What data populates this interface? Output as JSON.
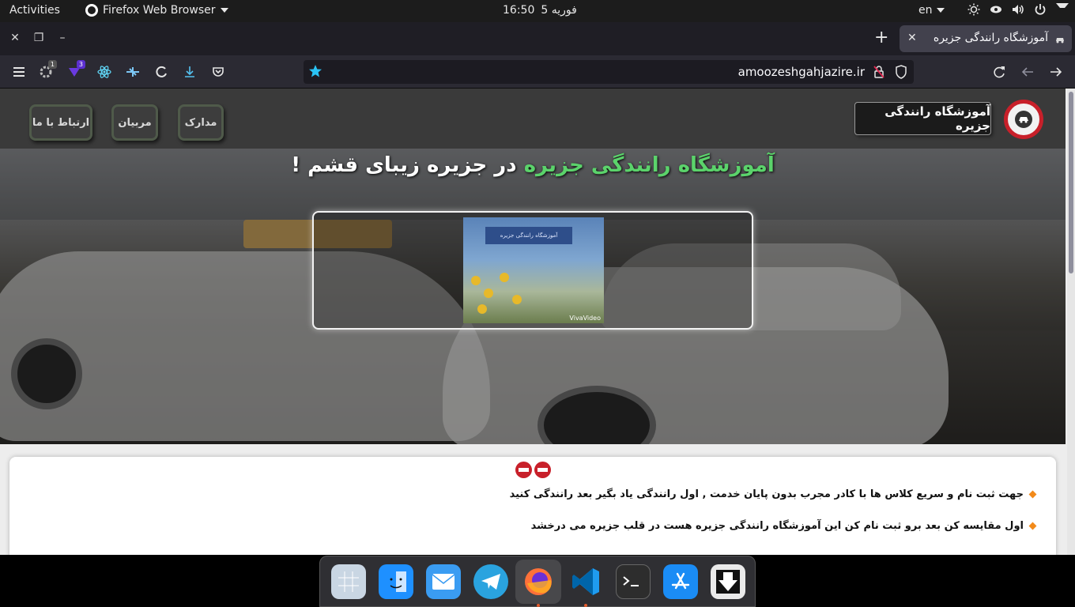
{
  "topbar": {
    "activities": "Activities",
    "app_name": "Firefox Web Browser",
    "time": "16:50",
    "date": "فوریه 5",
    "lang": "en"
  },
  "browser": {
    "tab_title": "آموزشگاه رانندگی جزیره",
    "url": "amoozeshgahjazire.ir",
    "badges": {
      "ext1": "1",
      "ext2": "3"
    }
  },
  "site": {
    "name": "آموزشگاه رانندگی جزیره",
    "nav": [
      "مدارک",
      "مربیان",
      "ارتباط با ما"
    ],
    "hero": {
      "title_green": "آموزشگاه رانندگی جزیره",
      "title_rest": "در جزیره زیبای قشم !",
      "video_banner": "آموزشگاه رانندگی جزیره",
      "video_watermark": "VivaVideo"
    },
    "bullets": [
      "جهت ثبت نام و سریع کلاس ها با کادر مجرب بدون پایان خدمت , اول رانندگی یاد بگیر بعد رانندگی کنید",
      "اول مقایسه کن بعد برو ثبت نام کن این آموزشگاه رانندگی جزیره هست در قلب جزیره می درخشد"
    ]
  },
  "colors": {
    "accent_green": "#5bd36b",
    "brand_red": "#c8202a",
    "bullet_orange": "#f28a1a"
  },
  "dock": [
    "grid-apps-icon",
    "finder-icon",
    "mail-icon",
    "telegram-icon",
    "firefox-icon",
    "vscode-icon",
    "terminal-icon",
    "app-store-icon",
    "download-icon"
  ]
}
